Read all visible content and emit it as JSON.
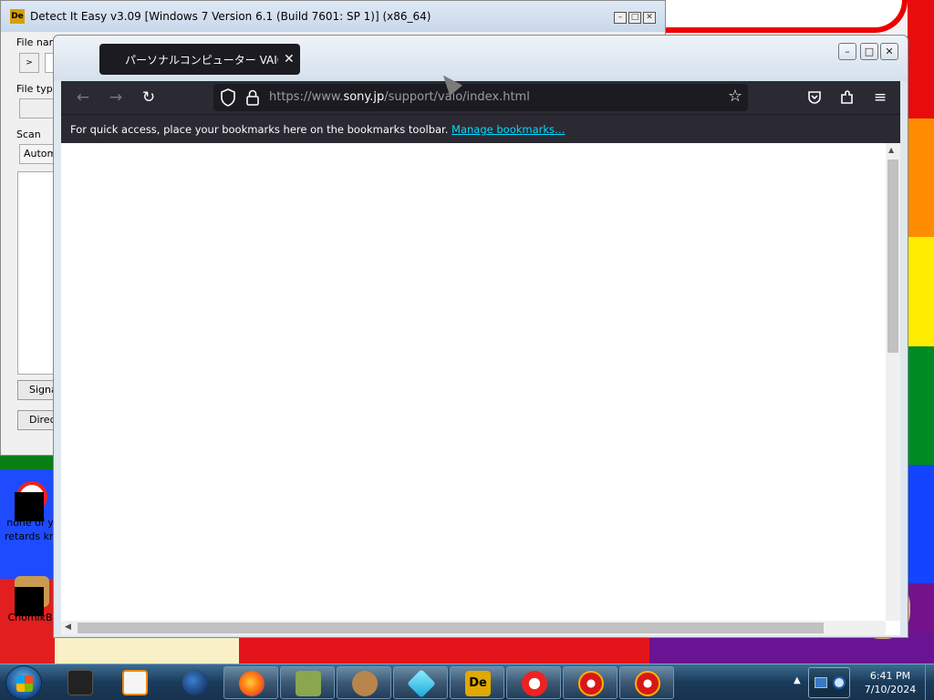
{
  "desktop": {
    "icons": [
      {
        "label_line1": "none of y",
        "label_line2": "retards kn"
      },
      {
        "label_line1": "ChomikB",
        "label_line2": ""
      }
    ]
  },
  "die_window": {
    "title": "Detect It Easy v3.09 [Windows 7 Version 6.1 (Build 7601: SP 1)] (x86_64)",
    "icon_text": "De",
    "file_name_label": "File nam",
    "file_type_label": "File type",
    "scan_label": "Scan",
    "scan_value": "Autom",
    "browse_glyph": ">",
    "signatures_button": "Signa",
    "directory_button": "Direc"
  },
  "browser": {
    "tab_title": "パーソナルコンピューター VAIO",
    "tab_close": "✕",
    "url_prefix": "https://www.",
    "url_host": "sony.jp",
    "url_path": "/support/vaio/index.html",
    "bookmarks_text": "For quick access, place your bookmarks here on the bookmarks toolbar.",
    "manage_bookmarks": "Manage bookmarks…",
    "icons": {
      "back": "←",
      "forward": "→",
      "reload": "↻",
      "star": "☆",
      "pocket": "◡",
      "extensions": "⧉",
      "menu": "≡"
    },
    "window_controls": {
      "minimize": "–",
      "maximize": "□",
      "close": "✕"
    }
  },
  "taskbar": {
    "time": "6:41 PM",
    "date": "7/10/2024",
    "show_hidden_icons": "▲"
  },
  "colors": {
    "firefox_toolbar": "#2b2a33",
    "urlbar": "#1c1b22",
    "link": "#00ddff"
  }
}
